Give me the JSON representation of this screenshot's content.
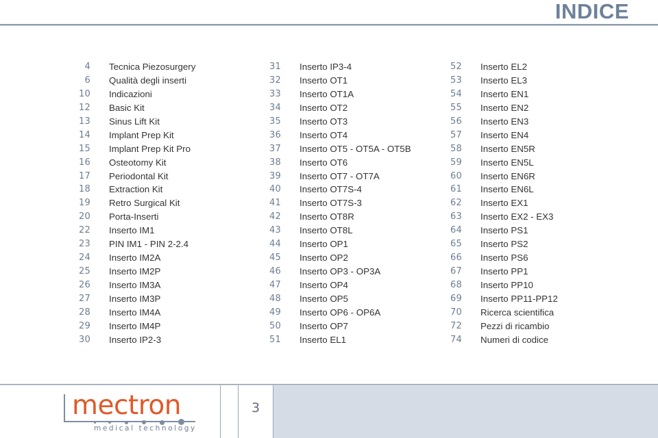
{
  "header": {
    "title": "INDICE"
  },
  "colors": {
    "title": "#6e819b",
    "page_number_text": "#6c7d92",
    "entry_text": "#333333",
    "rule": "#8e9bab",
    "footer_block": "#d6dce6",
    "logo_orange": "#e05a29",
    "logo_blue_gray": "#7d8da1"
  },
  "index": {
    "columns": [
      {
        "rows": [
          {
            "page": "4",
            "label": "Tecnica Piezosurgery"
          },
          {
            "page": "6",
            "label": "Qualità degli inserti"
          },
          {
            "page": "10",
            "label": "Indicazioni"
          },
          {
            "page": "12",
            "label": "Basic Kit"
          },
          {
            "page": "13",
            "label": "Sinus Lift Kit"
          },
          {
            "page": "14",
            "label": "Implant Prep Kit"
          },
          {
            "page": "15",
            "label": "Implant Prep Kit Pro"
          },
          {
            "page": "16",
            "label": "Osteotomy Kit"
          },
          {
            "page": "17",
            "label": "Periodontal Kit"
          },
          {
            "page": "18",
            "label": "Extraction Kit"
          },
          {
            "page": "19",
            "label": "Retro Surgical Kit"
          },
          {
            "page": "20",
            "label": "Porta-Inserti"
          },
          {
            "page": "22",
            "label": "Inserto IM1"
          },
          {
            "page": "23",
            "label": "PIN IM1 - PIN 2-2.4"
          },
          {
            "page": "24",
            "label": "Inserto IM2A"
          },
          {
            "page": "25",
            "label": "Inserto IM2P"
          },
          {
            "page": "26",
            "label": "Inserto IM3A"
          },
          {
            "page": "27",
            "label": "Inserto IM3P"
          },
          {
            "page": "28",
            "label": "Inserto IM4A"
          },
          {
            "page": "29",
            "label": "Inserto IM4P"
          },
          {
            "page": "30",
            "label": "Inserto IP2-3"
          }
        ]
      },
      {
        "rows": [
          {
            "page": "31",
            "label": "Inserto IP3-4"
          },
          {
            "page": "32",
            "label": "Inserto OT1"
          },
          {
            "page": "33",
            "label": "Inserto OT1A"
          },
          {
            "page": "34",
            "label": "Inserto OT2"
          },
          {
            "page": "35",
            "label": "Inserto OT3"
          },
          {
            "page": "36",
            "label": "Inserto OT4"
          },
          {
            "page": "37",
            "label": "Inserto OT5 - OT5A - OT5B"
          },
          {
            "page": "38",
            "label": "Inserto OT6"
          },
          {
            "page": "39",
            "label": "Inserto OT7 - OT7A"
          },
          {
            "page": "40",
            "label": "Inserto OT7S-4"
          },
          {
            "page": "41",
            "label": "Inserto OT7S-3"
          },
          {
            "page": "42",
            "label": "Inserto OT8R"
          },
          {
            "page": "43",
            "label": "Inserto OT8L"
          },
          {
            "page": "44",
            "label": "Inserto OP1"
          },
          {
            "page": "45",
            "label": "Inserto OP2"
          },
          {
            "page": "46",
            "label": "Inserto OP3 - OP3A"
          },
          {
            "page": "47",
            "label": "Inserto OP4"
          },
          {
            "page": "48",
            "label": "Inserto OP5"
          },
          {
            "page": "49",
            "label": "Inserto OP6 - OP6A"
          },
          {
            "page": "50",
            "label": "Inserto OP7"
          },
          {
            "page": "51",
            "label": "Inserto EL1"
          }
        ]
      },
      {
        "rows": [
          {
            "page": "52",
            "label": "Inserto EL2"
          },
          {
            "page": "53",
            "label": "Inserto EL3"
          },
          {
            "page": "54",
            "label": "Inserto EN1"
          },
          {
            "page": "55",
            "label": "Inserto EN2"
          },
          {
            "page": "56",
            "label": "Inserto EN3"
          },
          {
            "page": "57",
            "label": "Inserto EN4"
          },
          {
            "page": "58",
            "label": "Inserto EN5R"
          },
          {
            "page": "59",
            "label": "Inserto EN5L"
          },
          {
            "page": "60",
            "label": "Inserto EN6R"
          },
          {
            "page": "61",
            "label": "Inserto EN6L"
          },
          {
            "page": "62",
            "label": "Inserto EX1"
          },
          {
            "page": "63",
            "label": "Inserto EX2 - EX3"
          },
          {
            "page": "64",
            "label": "Inserto PS1"
          },
          {
            "page": "65",
            "label": "Inserto PS2"
          },
          {
            "page": "66",
            "label": "Inserto PS6"
          },
          {
            "page": "67",
            "label": "Inserto PP1"
          },
          {
            "page": "68",
            "label": "Inserto PP10"
          },
          {
            "page": "69",
            "label": "Inserto PP11-PP12"
          },
          {
            "page": "70",
            "label": "Ricerca scientifica"
          },
          {
            "page": "72",
            "label": "Pezzi di ricambio"
          },
          {
            "page": "74",
            "label": "Numeri di codice"
          }
        ]
      }
    ]
  },
  "footer": {
    "page_number": "3",
    "logo": {
      "wordmark": "mectron",
      "tagline": "medical technology",
      "dot_count": 6
    }
  }
}
